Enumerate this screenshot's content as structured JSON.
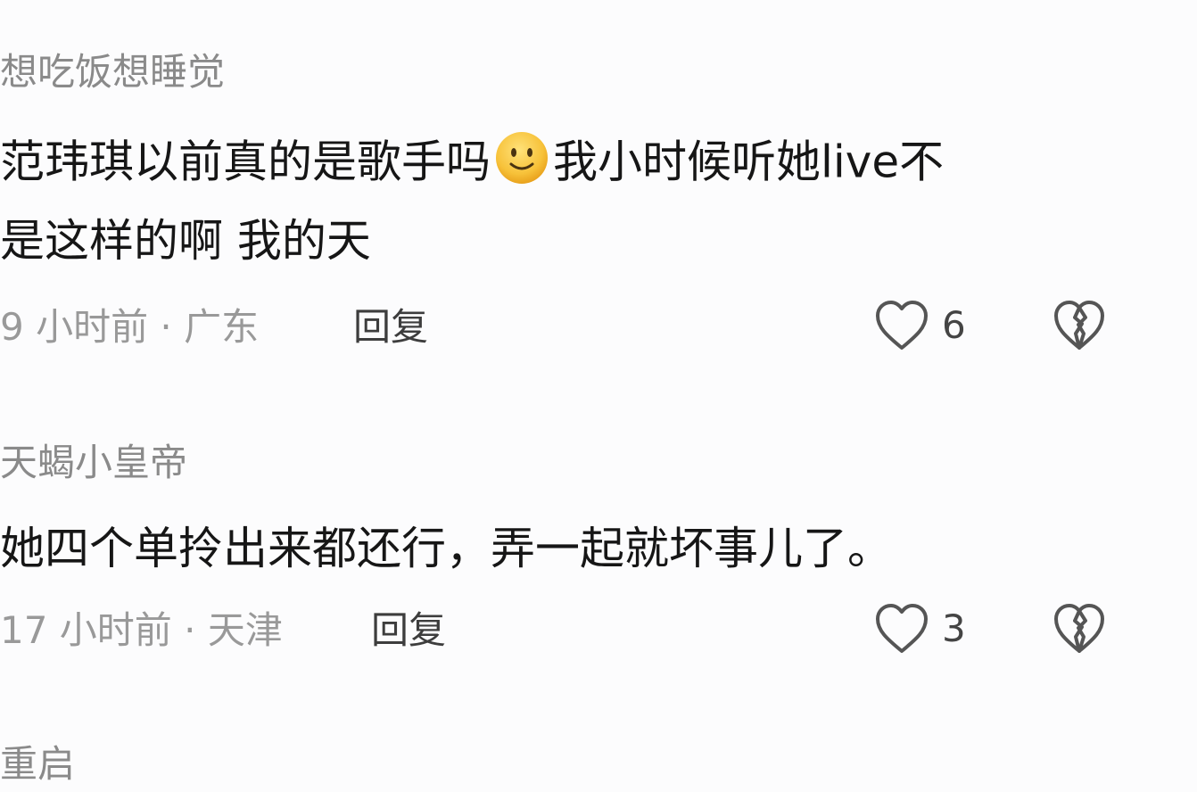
{
  "comments": [
    {
      "username": "想吃饭想睡觉",
      "line1_before_emoji": "范玮琪以前真的是歌手吗",
      "emoji": "slightly-smiling-face-emoji",
      "line1_after_emoji": "我小时候听她live不",
      "line2": "是这样的啊 我的天",
      "meta": "9 小时前 · 广东",
      "reply_label": "回复",
      "like_count": "6"
    },
    {
      "username": "天蝎小皇帝",
      "line1": "她四个单拎出来都还行，弄一起就坏事儿了。",
      "meta": "17 小时前 · 天津",
      "reply_label": "回复",
      "like_count": "3"
    },
    {
      "username": "重启"
    }
  ],
  "colors": {
    "background": "#fcfcfd",
    "username": "#8a8a8a",
    "content": "#161616",
    "meta": "#999999",
    "icon_stroke": "#555555",
    "emoji_fill": "#f7c23a"
  },
  "icons": {
    "like": "heart-outline-icon",
    "dislike": "broken-heart-icon"
  }
}
